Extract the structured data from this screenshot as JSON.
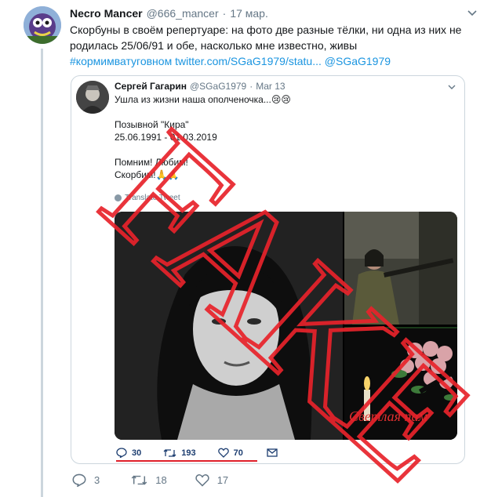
{
  "tweet": {
    "author_name": "Necro Mancer",
    "handle": "@666_mancer",
    "separator": "·",
    "date": "17 мар.",
    "text_line1": "Скорбуны в своём репертуаре: на фото две разные тёлки, ни одна из них не",
    "text_line2": "родилась 25/06/91 и обе, насколько мне известно, живы",
    "hashtag": "#кормимватуговном",
    "link": "twitter.com/SGaG1979/statu...",
    "mention": "@SGaG1979",
    "replies": "3",
    "retweets": "18",
    "likes": "17"
  },
  "quoted": {
    "author_name": "Сергей Гагарин",
    "handle": "@SGaG1979",
    "separator": "·",
    "date": "Mar 13",
    "line1": "Ушла из жизни наша ополченочка...😢😢",
    "line2": "Позывной \"Кира\"",
    "line3": "25.06.1991 - 01.03.2019",
    "line4": "Помним! Любим!",
    "line5": "Скорбим!🙏🙏",
    "translate_label": "Translate Tweet",
    "photo_caption": "Светлая пам",
    "replies": "30",
    "retweets": "193",
    "likes": "70"
  },
  "overlay": {
    "stamp_text": "FAKE",
    "color": "#e8232b"
  },
  "colors": {
    "link": "#1b95e0",
    "muted": "#657786",
    "border": "#ccd6dd",
    "quote_actions": "#1c3d70"
  }
}
